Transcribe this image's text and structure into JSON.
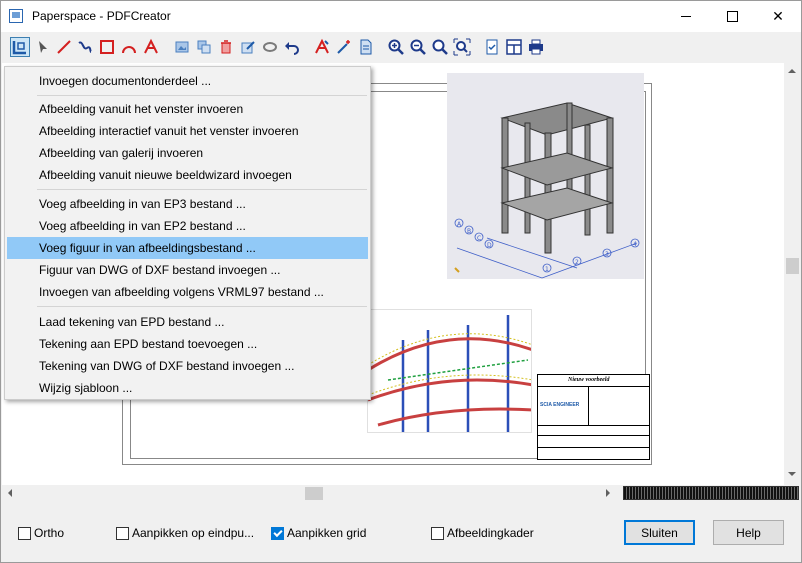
{
  "window": {
    "title": "Paperspace - PDFCreator",
    "close_glyph": "✕"
  },
  "toolbar": {
    "tools": [
      {
        "name": "insert-layout-icon",
        "color": "#1e5aa8"
      },
      {
        "name": "pointer-icon",
        "color": "#555555"
      },
      {
        "name": "line-icon",
        "color": "#d42020"
      },
      {
        "name": "polyline-icon",
        "color": "#1e3a8a"
      },
      {
        "name": "rectangle-icon",
        "color": "#d42020"
      },
      {
        "name": "arc-icon",
        "color": "#d42020"
      },
      {
        "name": "text-icon",
        "color": "#d42020"
      },
      {
        "name": "picture-icon",
        "color": "#4a7fbf"
      },
      {
        "name": "copy-icon",
        "color": "#4a7fbf"
      },
      {
        "name": "delete-icon",
        "color": "#d42020"
      },
      {
        "name": "edit-icon",
        "color": "#4a7fbf"
      },
      {
        "name": "rotate-icon",
        "color": "#7a7a7a"
      },
      {
        "name": "undo-icon",
        "color": "#1e3a8a"
      },
      {
        "name": "text-style-icon",
        "color": "#d42020"
      },
      {
        "name": "magic-wand-icon",
        "color": "#d42020"
      },
      {
        "name": "document-icon",
        "color": "#1e5aa8"
      },
      {
        "name": "zoom-in-icon",
        "color": "#1e3a8a"
      },
      {
        "name": "zoom-out-icon",
        "color": "#1e3a8a"
      },
      {
        "name": "zoom-all-icon",
        "color": "#1e3a8a"
      },
      {
        "name": "zoom-window-icon",
        "color": "#1e3a8a"
      },
      {
        "name": "checklist-icon",
        "color": "#1e5aa8"
      },
      {
        "name": "layout-icon",
        "color": "#1e3a8a"
      },
      {
        "name": "print-icon",
        "color": "#1e3a8a"
      }
    ]
  },
  "menu": {
    "items": [
      "Invoegen documentonderdeel ...",
      "Afbeelding vanuit het venster invoeren",
      "Afbeelding interactief vanuit het venster invoeren",
      "Afbeelding van galerij invoeren",
      "Afbeelding vanuit nieuwe beeldwizard invoegen",
      "Voeg afbeelding in van EP3 bestand ...",
      "Voeg afbeelding in van EP2 bestand ...",
      "Voeg figuur in van afbeeldingsbestand ...",
      "Figuur van DWG of DXF bestand invoegen ...",
      "Invoegen van afbeelding volgens VRML97 bestand ...",
      "Laad tekening van EPD bestand ...",
      "Tekening aan EPD bestand toevoegen ...",
      "Tekening van DWG of DXF bestand invoegen ...",
      "Wijzig sjabloon ..."
    ],
    "highlighted_index": 7,
    "highlight_color": "#91c9f7"
  },
  "titleblock": {
    "title": "Nieuw voorbeeld",
    "logo": "SCIA ENGINEER"
  },
  "drawing_labels": {
    "grid_letters": [
      "A",
      "B",
      "C",
      "D"
    ],
    "grid_numbers": [
      "1",
      "2",
      "3",
      "4"
    ]
  },
  "footer": {
    "ortho": {
      "label": "Ortho",
      "checked": false
    },
    "snap_endpoint": {
      "label": "Aanpikken op eindpu...",
      "checked": false
    },
    "snap_grid": {
      "label": "Aanpikken grid",
      "checked": true
    },
    "image_frame": {
      "label": "Afbeeldingkader",
      "checked": false
    },
    "close_button": "Sluiten",
    "help_button": "Help"
  }
}
